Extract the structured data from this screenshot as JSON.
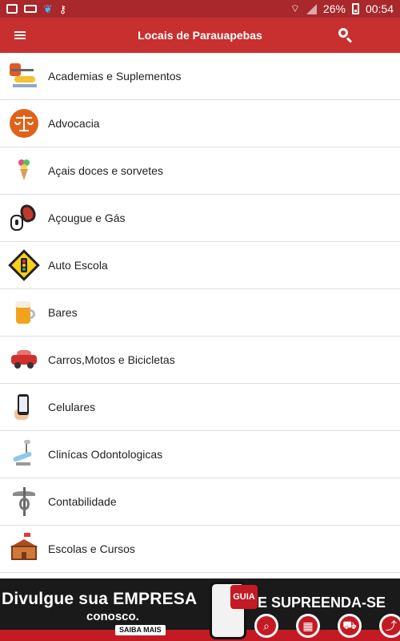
{
  "status_bar": {
    "battery_percent": "26%",
    "time": "00:54"
  },
  "app_bar": {
    "title": "Locais de Parauapebas"
  },
  "list": [
    {
      "label": "Academias e Suplementos",
      "icon": "gym-icon"
    },
    {
      "label": "Advocacia",
      "icon": "scales-icon"
    },
    {
      "label": "Açais doces e sorvetes",
      "icon": "ice-cream-icon"
    },
    {
      "label": "Açougue e Gás",
      "icon": "meat-gas-icon"
    },
    {
      "label": "Auto Escola",
      "icon": "traffic-light-icon"
    },
    {
      "label": "Bares",
      "icon": "beer-icon"
    },
    {
      "label": "Carros,Motos e Bicicletas",
      "icon": "car-icon"
    },
    {
      "label": "Celulares",
      "icon": "phone-icon"
    },
    {
      "label": "Clinícas Odontologicas",
      "icon": "dentist-icon"
    },
    {
      "label": "Contabilidade",
      "icon": "caduceus-icon"
    },
    {
      "label": "Escolas e Cursos",
      "icon": "school-icon"
    }
  ],
  "banner": {
    "headline": "Divulgue sua EMPRESA",
    "subline": "conosco.",
    "button": "SAIBA MAIS",
    "brand": "GUIA",
    "cta": "E SUPREENDA-SE"
  },
  "colors": {
    "status_bar": "#a8282b",
    "app_bar": "#c7302f",
    "divider": "#dedede"
  }
}
